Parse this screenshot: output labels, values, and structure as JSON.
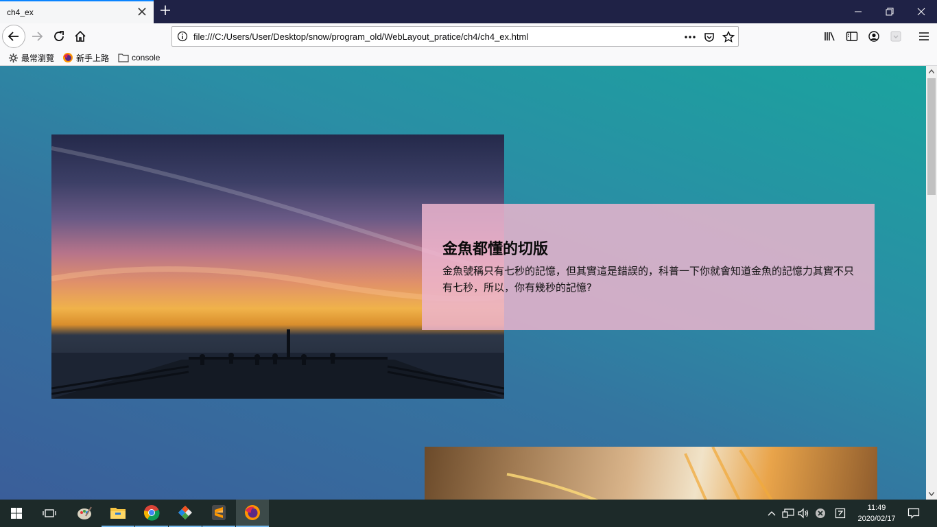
{
  "browser": {
    "tab": {
      "title": "ch4_ex"
    },
    "url": "file:///C:/Users/User/Desktop/snow/program_old/WebLayout_pratice/ch4/ch4_ex.html",
    "bookmarks": [
      {
        "label": "最常瀏覽",
        "icon": "gear-icon"
      },
      {
        "label": "新手上路",
        "icon": "firefox-icon"
      },
      {
        "label": "console",
        "icon": "folder-icon"
      }
    ]
  },
  "page": {
    "card": {
      "title": "金魚都懂的切版",
      "text": "金魚號稱只有七秒的記憶，但其實這是錯誤的，科普一下你就會知道金魚的記憶力其實不只有七秒，所以，你有幾秒的記憶?"
    }
  },
  "taskbar": {
    "time": "11:49",
    "date": "2020/02/17"
  },
  "colors": {
    "accent": "#0a84ff",
    "tabbar": "#1f2246",
    "card": "#ecb5ce"
  }
}
